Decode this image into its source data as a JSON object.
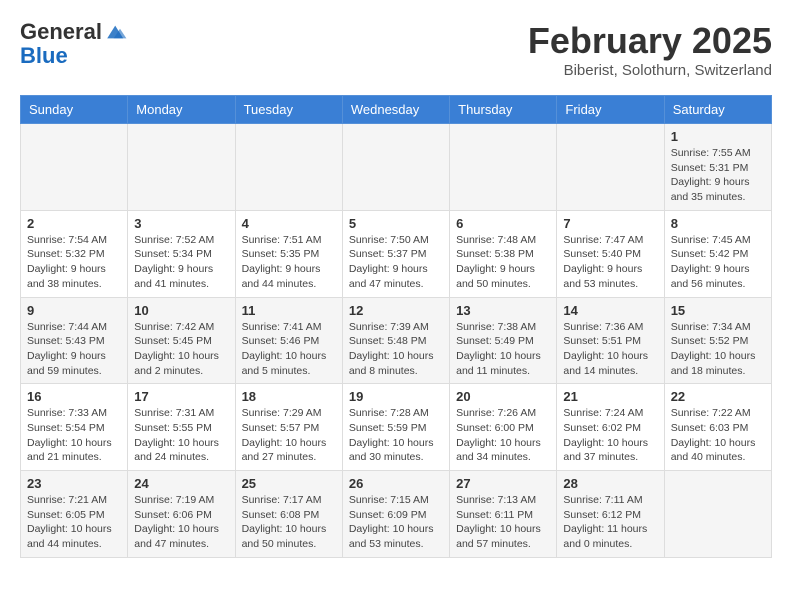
{
  "header": {
    "logo_line1": "General",
    "logo_line2": "Blue",
    "month": "February 2025",
    "location": "Biberist, Solothurn, Switzerland"
  },
  "weekdays": [
    "Sunday",
    "Monday",
    "Tuesday",
    "Wednesday",
    "Thursday",
    "Friday",
    "Saturday"
  ],
  "weeks": [
    [
      {
        "day": "",
        "info": ""
      },
      {
        "day": "",
        "info": ""
      },
      {
        "day": "",
        "info": ""
      },
      {
        "day": "",
        "info": ""
      },
      {
        "day": "",
        "info": ""
      },
      {
        "day": "",
        "info": ""
      },
      {
        "day": "1",
        "info": "Sunrise: 7:55 AM\nSunset: 5:31 PM\nDaylight: 9 hours and 35 minutes."
      }
    ],
    [
      {
        "day": "2",
        "info": "Sunrise: 7:54 AM\nSunset: 5:32 PM\nDaylight: 9 hours and 38 minutes."
      },
      {
        "day": "3",
        "info": "Sunrise: 7:52 AM\nSunset: 5:34 PM\nDaylight: 9 hours and 41 minutes."
      },
      {
        "day": "4",
        "info": "Sunrise: 7:51 AM\nSunset: 5:35 PM\nDaylight: 9 hours and 44 minutes."
      },
      {
        "day": "5",
        "info": "Sunrise: 7:50 AM\nSunset: 5:37 PM\nDaylight: 9 hours and 47 minutes."
      },
      {
        "day": "6",
        "info": "Sunrise: 7:48 AM\nSunset: 5:38 PM\nDaylight: 9 hours and 50 minutes."
      },
      {
        "day": "7",
        "info": "Sunrise: 7:47 AM\nSunset: 5:40 PM\nDaylight: 9 hours and 53 minutes."
      },
      {
        "day": "8",
        "info": "Sunrise: 7:45 AM\nSunset: 5:42 PM\nDaylight: 9 hours and 56 minutes."
      }
    ],
    [
      {
        "day": "9",
        "info": "Sunrise: 7:44 AM\nSunset: 5:43 PM\nDaylight: 9 hours and 59 minutes."
      },
      {
        "day": "10",
        "info": "Sunrise: 7:42 AM\nSunset: 5:45 PM\nDaylight: 10 hours and 2 minutes."
      },
      {
        "day": "11",
        "info": "Sunrise: 7:41 AM\nSunset: 5:46 PM\nDaylight: 10 hours and 5 minutes."
      },
      {
        "day": "12",
        "info": "Sunrise: 7:39 AM\nSunset: 5:48 PM\nDaylight: 10 hours and 8 minutes."
      },
      {
        "day": "13",
        "info": "Sunrise: 7:38 AM\nSunset: 5:49 PM\nDaylight: 10 hours and 11 minutes."
      },
      {
        "day": "14",
        "info": "Sunrise: 7:36 AM\nSunset: 5:51 PM\nDaylight: 10 hours and 14 minutes."
      },
      {
        "day": "15",
        "info": "Sunrise: 7:34 AM\nSunset: 5:52 PM\nDaylight: 10 hours and 18 minutes."
      }
    ],
    [
      {
        "day": "16",
        "info": "Sunrise: 7:33 AM\nSunset: 5:54 PM\nDaylight: 10 hours and 21 minutes."
      },
      {
        "day": "17",
        "info": "Sunrise: 7:31 AM\nSunset: 5:55 PM\nDaylight: 10 hours and 24 minutes."
      },
      {
        "day": "18",
        "info": "Sunrise: 7:29 AM\nSunset: 5:57 PM\nDaylight: 10 hours and 27 minutes."
      },
      {
        "day": "19",
        "info": "Sunrise: 7:28 AM\nSunset: 5:59 PM\nDaylight: 10 hours and 30 minutes."
      },
      {
        "day": "20",
        "info": "Sunrise: 7:26 AM\nSunset: 6:00 PM\nDaylight: 10 hours and 34 minutes."
      },
      {
        "day": "21",
        "info": "Sunrise: 7:24 AM\nSunset: 6:02 PM\nDaylight: 10 hours and 37 minutes."
      },
      {
        "day": "22",
        "info": "Sunrise: 7:22 AM\nSunset: 6:03 PM\nDaylight: 10 hours and 40 minutes."
      }
    ],
    [
      {
        "day": "23",
        "info": "Sunrise: 7:21 AM\nSunset: 6:05 PM\nDaylight: 10 hours and 44 minutes."
      },
      {
        "day": "24",
        "info": "Sunrise: 7:19 AM\nSunset: 6:06 PM\nDaylight: 10 hours and 47 minutes."
      },
      {
        "day": "25",
        "info": "Sunrise: 7:17 AM\nSunset: 6:08 PM\nDaylight: 10 hours and 50 minutes."
      },
      {
        "day": "26",
        "info": "Sunrise: 7:15 AM\nSunset: 6:09 PM\nDaylight: 10 hours and 53 minutes."
      },
      {
        "day": "27",
        "info": "Sunrise: 7:13 AM\nSunset: 6:11 PM\nDaylight: 10 hours and 57 minutes."
      },
      {
        "day": "28",
        "info": "Sunrise: 7:11 AM\nSunset: 6:12 PM\nDaylight: 11 hours and 0 minutes."
      },
      {
        "day": "",
        "info": ""
      }
    ]
  ]
}
